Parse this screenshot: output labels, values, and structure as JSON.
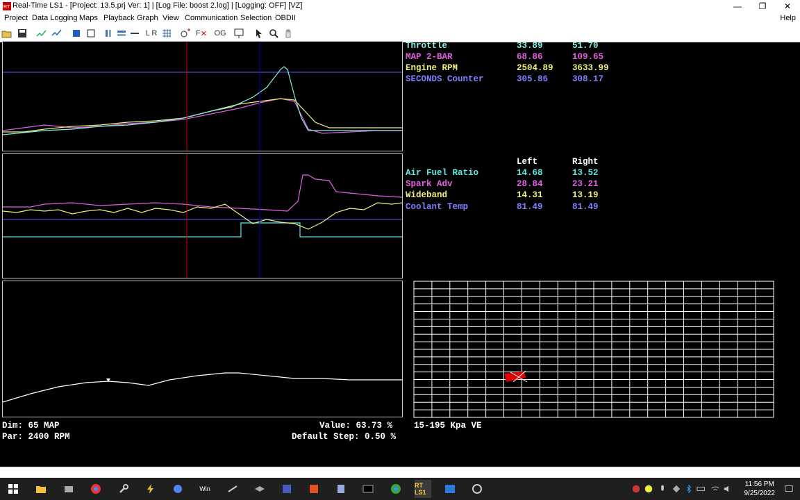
{
  "window": {
    "title": "Real-Time LS1 - [Project: 13.5.prj Ver: 1] | [Log File: boost 2.log] | [Logging: OFF] [VZ]",
    "minimize": "—",
    "maximize": "❐",
    "close": "✕"
  },
  "menu": {
    "items": [
      "Project",
      "Data Logging",
      "Maps",
      "Playback",
      "Graph",
      "View",
      "Communication",
      "Selection",
      "OBDII"
    ],
    "help": "Help"
  },
  "toolbar": {
    "lr_label": "L R",
    "fx_label": "F",
    "og_label": "OG"
  },
  "colors": {
    "throttle": "#86f0e0",
    "map": "#e060e0",
    "rpm": "#f0f080",
    "seconds": "#8080ff",
    "afr": "#60e8e0",
    "spark": "#e060e0",
    "wideband": "#f0f080",
    "coolant": "#8080ff",
    "cursor_red": "#cc0000",
    "cursor_blue": "#0000cc",
    "cell_marker": "#dd0000"
  },
  "readouts_top": [
    {
      "name": "Throttle",
      "a": "33.89",
      "b": "51.70"
    },
    {
      "name": "MAP 2-BAR",
      "a": "68.86",
      "b": "109.65"
    },
    {
      "name": "Engine RPM",
      "a": "2504.89",
      "b": "3633.99"
    },
    {
      "name": "SECONDS Counter",
      "a": "305.86",
      "b": "308.17"
    }
  ],
  "readouts_bottom_header": {
    "left": "Left",
    "right": "Right"
  },
  "readouts_bottom": [
    {
      "name": "Air Fuel Ratio",
      "a": "14.68",
      "b": "13.52"
    },
    {
      "name": "Spark Adv",
      "a": "28.84",
      "b": "23.21"
    },
    {
      "name": "Wideband",
      "a": "14.31",
      "b": "13.19"
    },
    {
      "name": "Coolant Temp",
      "a": "81.49",
      "b": "81.49"
    }
  ],
  "status": {
    "dim": "Dim: 65 MAP",
    "par": "Par: 2400 RPM",
    "value": "Value: 63.73 %",
    "default_step": "Default Step: 0.50 %",
    "table_name": "15-195 Kpa VE"
  },
  "taskbar": {
    "time": "11:56 PM",
    "date": "9/25/2022",
    "rt_label": "RT LS1",
    "win_label": "Win"
  }
}
